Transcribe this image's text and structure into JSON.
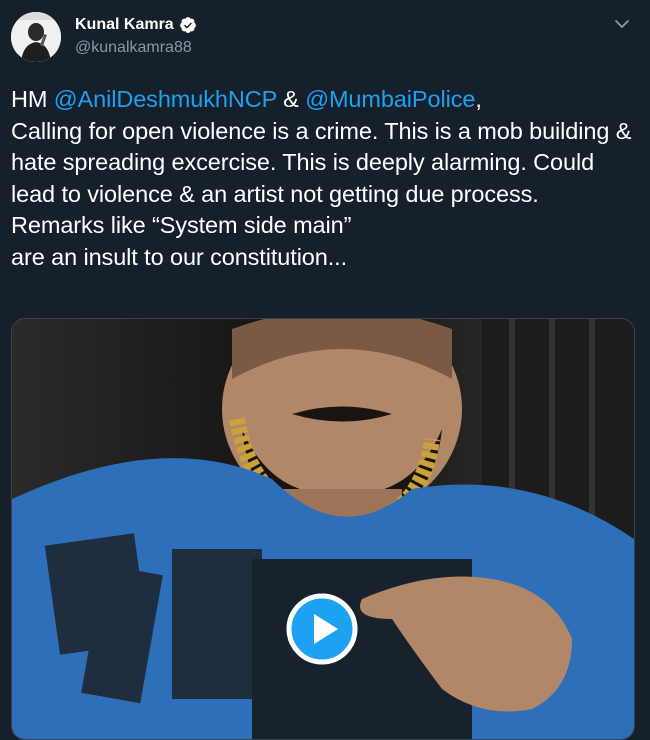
{
  "author": {
    "display_name": "Kunal Kamra",
    "handle": "@kunalkamra88",
    "verified": true
  },
  "tweet": {
    "prefix": "HM ",
    "mention_1": "@AnilDeshmukhNCP",
    "joiner": " & ",
    "mention_2": "@MumbaiPolice",
    "suffix": ",",
    "body": "Calling for open violence is a crime. This is a mob building & hate spreading excercise. This is deeply alarming. Could lead to violence & an artist not getting due process.\nRemarks like “System side main”\nare an insult to our constitution..."
  },
  "media": {
    "type": "video",
    "play_icon": "play-icon"
  },
  "colors": {
    "background": "#15202b",
    "link": "#1da1f2",
    "secondary_text": "#8899a6",
    "verified_badge": "#ffffff"
  }
}
